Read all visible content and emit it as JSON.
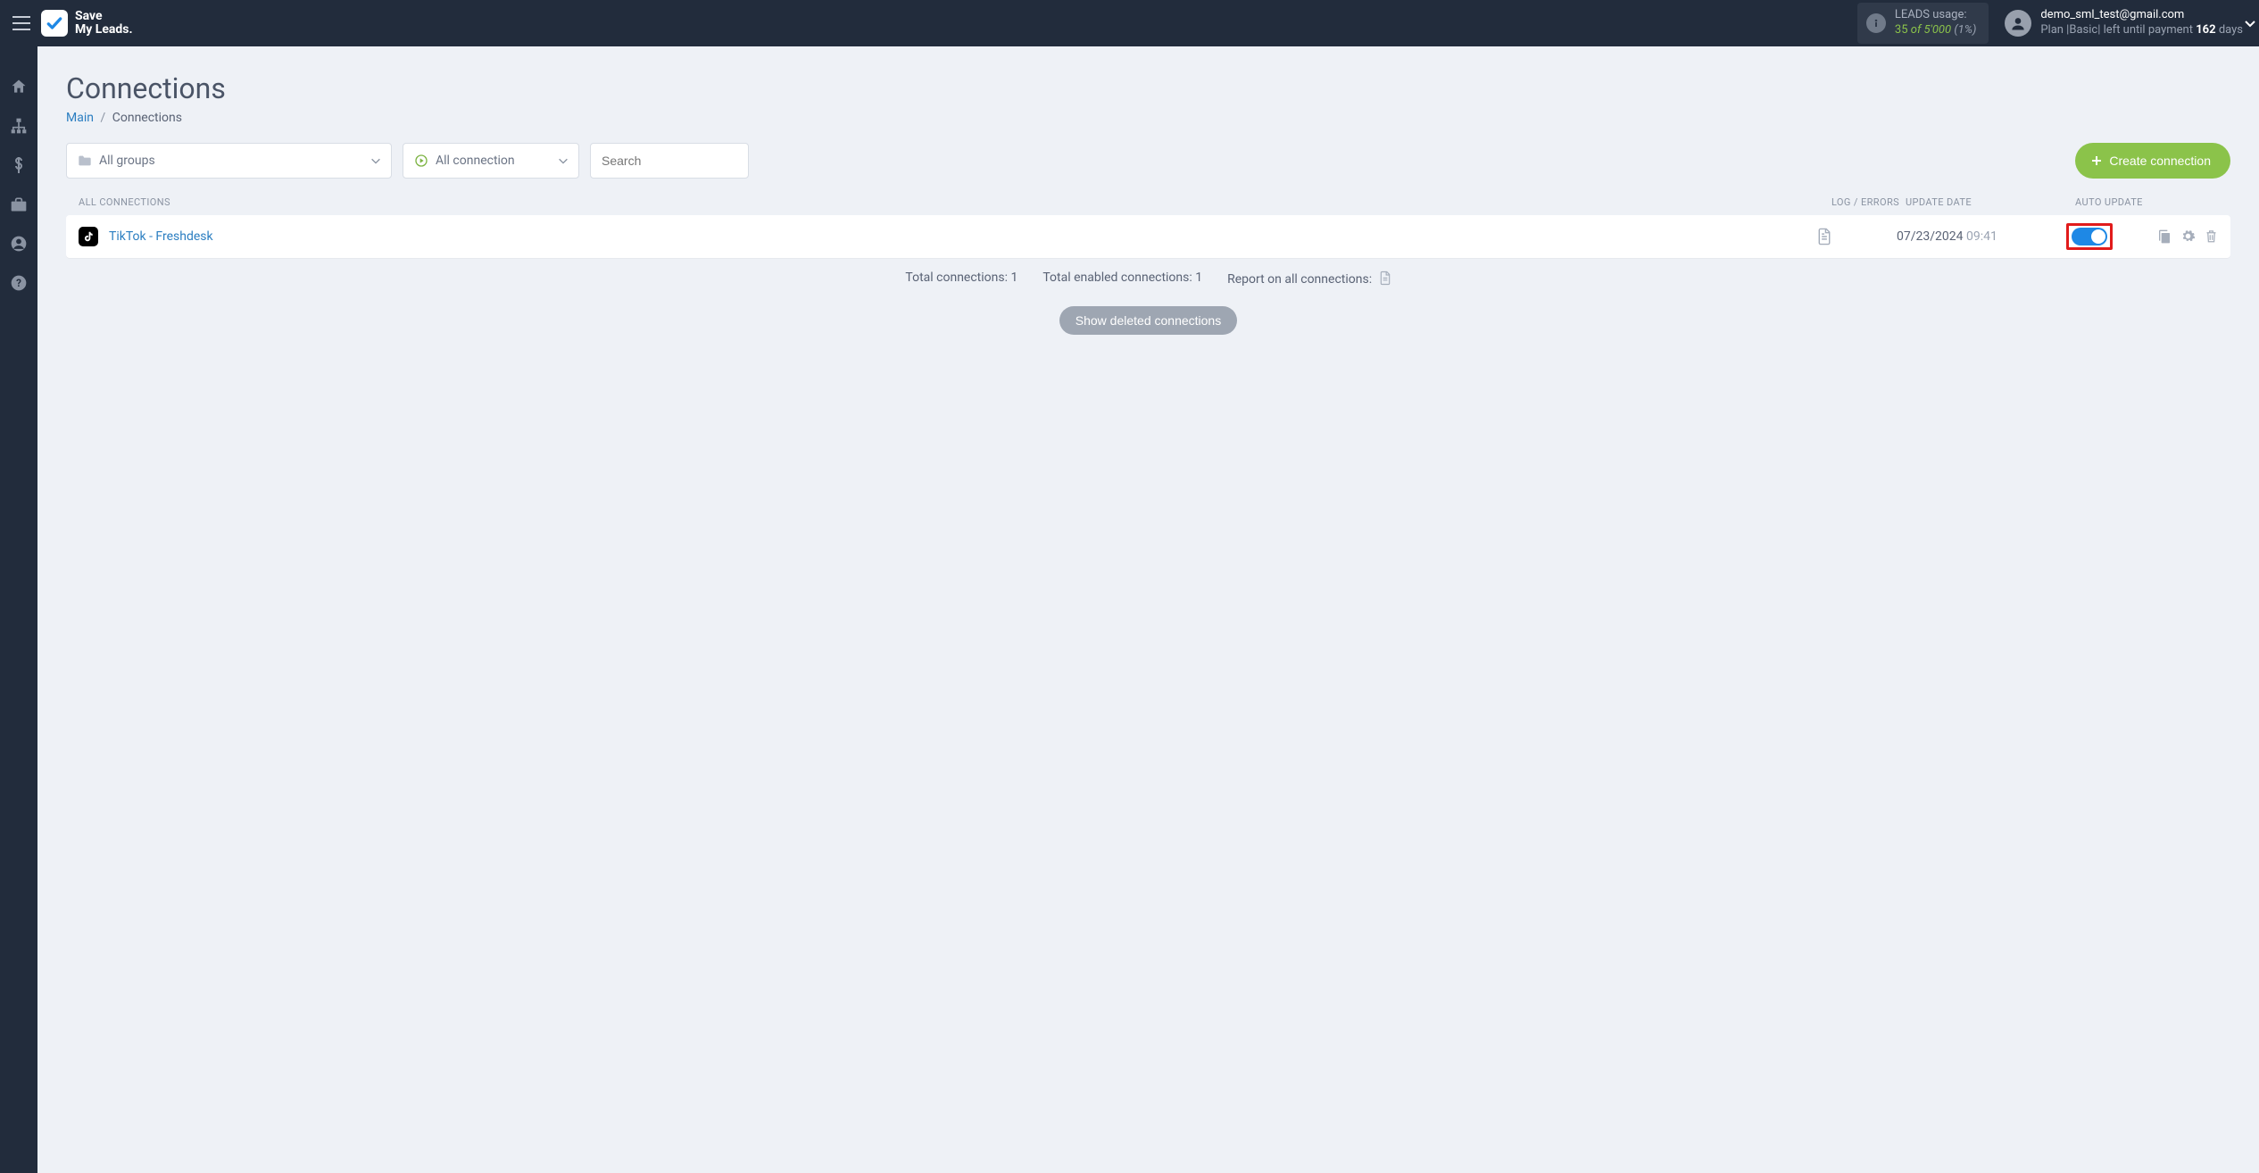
{
  "brand": {
    "line1": "Save",
    "line2": "My Leads."
  },
  "leads": {
    "label": "LEADS usage:",
    "used": "35",
    "of": "of",
    "total": "5'000",
    "pct": "(1%)"
  },
  "user": {
    "email": "demo_sml_test@gmail.com",
    "plan_prefix": "Plan |",
    "plan_name": "Basic",
    "plan_mid": "| left until payment ",
    "days": "162",
    "days_suffix": " days"
  },
  "page": {
    "title": "Connections"
  },
  "breadcrumb": {
    "main": "Main",
    "current": "Connections"
  },
  "filters": {
    "groups": "All groups",
    "status": "All connection",
    "search_placeholder": "Search"
  },
  "create_label": "Create connection",
  "columns": {
    "name": "ALL CONNECTIONS",
    "log": "LOG / ERRORS",
    "date": "UPDATE DATE",
    "auto": "AUTO UPDATE"
  },
  "rows": [
    {
      "name": "TikTok - Freshdesk",
      "date": "07/23/2024",
      "time": "09:41"
    }
  ],
  "totals": {
    "total_label": "Total connections: ",
    "total_val": "1",
    "enabled_label": "Total enabled connections: ",
    "enabled_val": "1",
    "report_label": "Report on all connections:"
  },
  "show_deleted": "Show deleted connections"
}
